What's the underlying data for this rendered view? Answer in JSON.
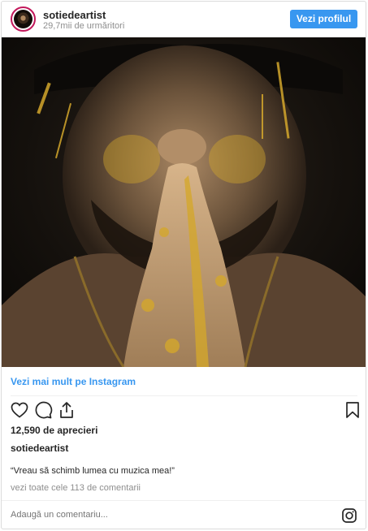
{
  "header": {
    "username": "sotiedeartist",
    "followers": "29,7mii de urmăritori",
    "profile_button": "Vezi profilul"
  },
  "post": {
    "view_more": "Vezi mai mult pe Instagram",
    "likes": "12,590 de aprecieri",
    "owner": "sotiedeartist",
    "caption": "“Vreau să schimb lumea cu muzica mea!”",
    "comments_link": "vezi toate cele 113 de comentarii"
  },
  "comment": {
    "placeholder": "Adaugă un comentariu..."
  },
  "icons": {
    "like": "heart-icon",
    "comment": "comment-icon",
    "share": "share-icon",
    "save": "bookmark-icon",
    "instagram": "instagram-icon"
  },
  "colors": {
    "accent": "#3897f0",
    "text": "#262626",
    "muted": "#8e8e8e"
  }
}
